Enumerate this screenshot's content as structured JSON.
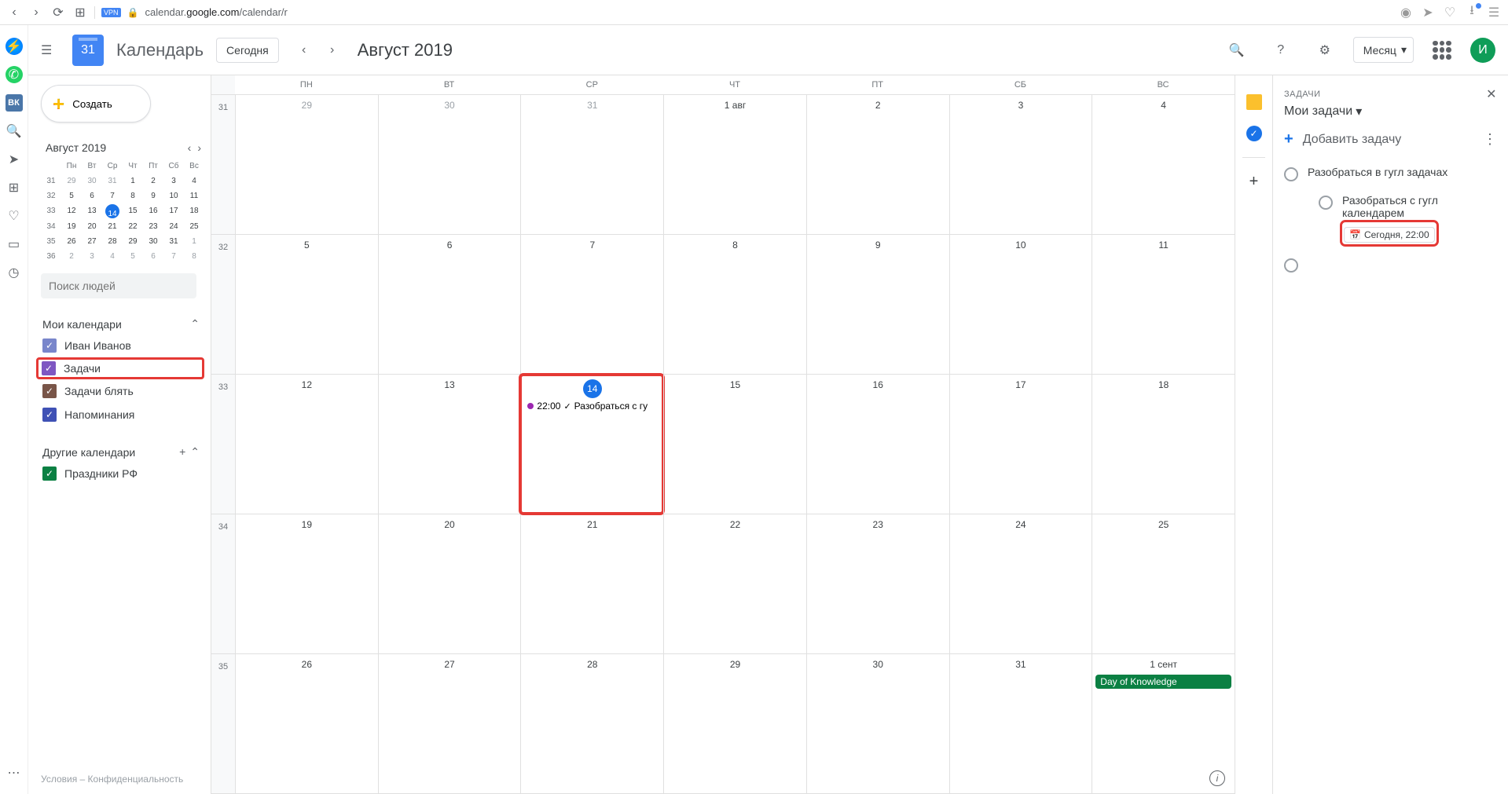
{
  "browser": {
    "url_pre": "calendar.",
    "url_host": "google.com",
    "url_path": "/calendar/r"
  },
  "os_sidebar": {
    "vk": "ВК"
  },
  "header": {
    "logo_day": "31",
    "app_title": "Календарь",
    "today": "Сегодня",
    "month_label": "Август 2019",
    "view": "Месяц",
    "avatar": "И"
  },
  "sidebar": {
    "create": "Создать",
    "mini_month": "Август 2019",
    "mini_dow": [
      "Пн",
      "Вт",
      "Ср",
      "Чт",
      "Пт",
      "Сб",
      "Вс"
    ],
    "mini_weeks": [
      {
        "wk": "31",
        "days": [
          {
            "n": "29",
            "dim": true
          },
          {
            "n": "30",
            "dim": true
          },
          {
            "n": "31",
            "dim": true
          },
          {
            "n": "1"
          },
          {
            "n": "2"
          },
          {
            "n": "3"
          },
          {
            "n": "4"
          }
        ]
      },
      {
        "wk": "32",
        "days": [
          {
            "n": "5"
          },
          {
            "n": "6"
          },
          {
            "n": "7"
          },
          {
            "n": "8"
          },
          {
            "n": "9"
          },
          {
            "n": "10"
          },
          {
            "n": "11"
          }
        ]
      },
      {
        "wk": "33",
        "days": [
          {
            "n": "12"
          },
          {
            "n": "13"
          },
          {
            "n": "14",
            "today": true
          },
          {
            "n": "15"
          },
          {
            "n": "16"
          },
          {
            "n": "17"
          },
          {
            "n": "18"
          }
        ]
      },
      {
        "wk": "34",
        "days": [
          {
            "n": "19"
          },
          {
            "n": "20"
          },
          {
            "n": "21"
          },
          {
            "n": "22"
          },
          {
            "n": "23"
          },
          {
            "n": "24"
          },
          {
            "n": "25"
          }
        ]
      },
      {
        "wk": "35",
        "days": [
          {
            "n": "26"
          },
          {
            "n": "27"
          },
          {
            "n": "28"
          },
          {
            "n": "29"
          },
          {
            "n": "30"
          },
          {
            "n": "31"
          },
          {
            "n": "1",
            "dim": true
          }
        ]
      },
      {
        "wk": "36",
        "days": [
          {
            "n": "2",
            "dim": true
          },
          {
            "n": "3",
            "dim": true
          },
          {
            "n": "4",
            "dim": true
          },
          {
            "n": "5",
            "dim": true
          },
          {
            "n": "6",
            "dim": true
          },
          {
            "n": "7",
            "dim": true
          },
          {
            "n": "8",
            "dim": true
          }
        ]
      }
    ],
    "search_placeholder": "Поиск людей",
    "my_calendars_label": "Мои календари",
    "my_calendars": [
      {
        "label": "Иван Иванов",
        "color": "#7986cb"
      },
      {
        "label": "Задачи",
        "color": "#7e57c2",
        "highlight": true
      },
      {
        "label": "Задачи блять",
        "color": "#795548"
      },
      {
        "label": "Напоминания",
        "color": "#3f51b5"
      }
    ],
    "other_calendars_label": "Другие календари",
    "other_calendars": [
      {
        "label": "Праздники РФ",
        "color": "#0b8043"
      }
    ],
    "footer": "Условия – Конфиденциальность"
  },
  "grid": {
    "dow": [
      "ПН",
      "ВТ",
      "СР",
      "ЧТ",
      "ПТ",
      "СБ",
      "ВС"
    ],
    "weeks": [
      {
        "wk": "31",
        "days": [
          {
            "n": "29",
            "dim": true
          },
          {
            "n": "30",
            "dim": true
          },
          {
            "n": "31",
            "dim": true
          },
          {
            "n": "1 авг"
          },
          {
            "n": "2"
          },
          {
            "n": "3"
          },
          {
            "n": "4"
          }
        ]
      },
      {
        "wk": "32",
        "days": [
          {
            "n": "5"
          },
          {
            "n": "6"
          },
          {
            "n": "7"
          },
          {
            "n": "8"
          },
          {
            "n": "9"
          },
          {
            "n": "10"
          },
          {
            "n": "11"
          }
        ]
      },
      {
        "wk": "33",
        "days": [
          {
            "n": "12"
          },
          {
            "n": "13"
          },
          {
            "n": "14",
            "today": true,
            "highlight": true,
            "event": {
              "time": "22:00",
              "title": "Разобраться с гу"
            }
          },
          {
            "n": "15"
          },
          {
            "n": "16"
          },
          {
            "n": "17"
          },
          {
            "n": "18"
          }
        ]
      },
      {
        "wk": "34",
        "days": [
          {
            "n": "19"
          },
          {
            "n": "20"
          },
          {
            "n": "21"
          },
          {
            "n": "22"
          },
          {
            "n": "23"
          },
          {
            "n": "24"
          },
          {
            "n": "25"
          }
        ]
      },
      {
        "wk": "35",
        "days": [
          {
            "n": "26"
          },
          {
            "n": "27"
          },
          {
            "n": "28"
          },
          {
            "n": "29"
          },
          {
            "n": "30"
          },
          {
            "n": "31"
          },
          {
            "n": "1 сент",
            "bar": "Day of Knowledge"
          }
        ]
      }
    ]
  },
  "tasks": {
    "label": "ЗАДАЧИ",
    "list_name": "Мои задачи",
    "add": "Добавить задачу",
    "items": [
      {
        "title": "Разобраться в гугл задачах"
      },
      {
        "title": "Разобраться с гугл календарем",
        "sub": true,
        "date": "Сегодня, 22:00",
        "highlight_date": true
      },
      {
        "title": "",
        "empty": true
      }
    ]
  }
}
